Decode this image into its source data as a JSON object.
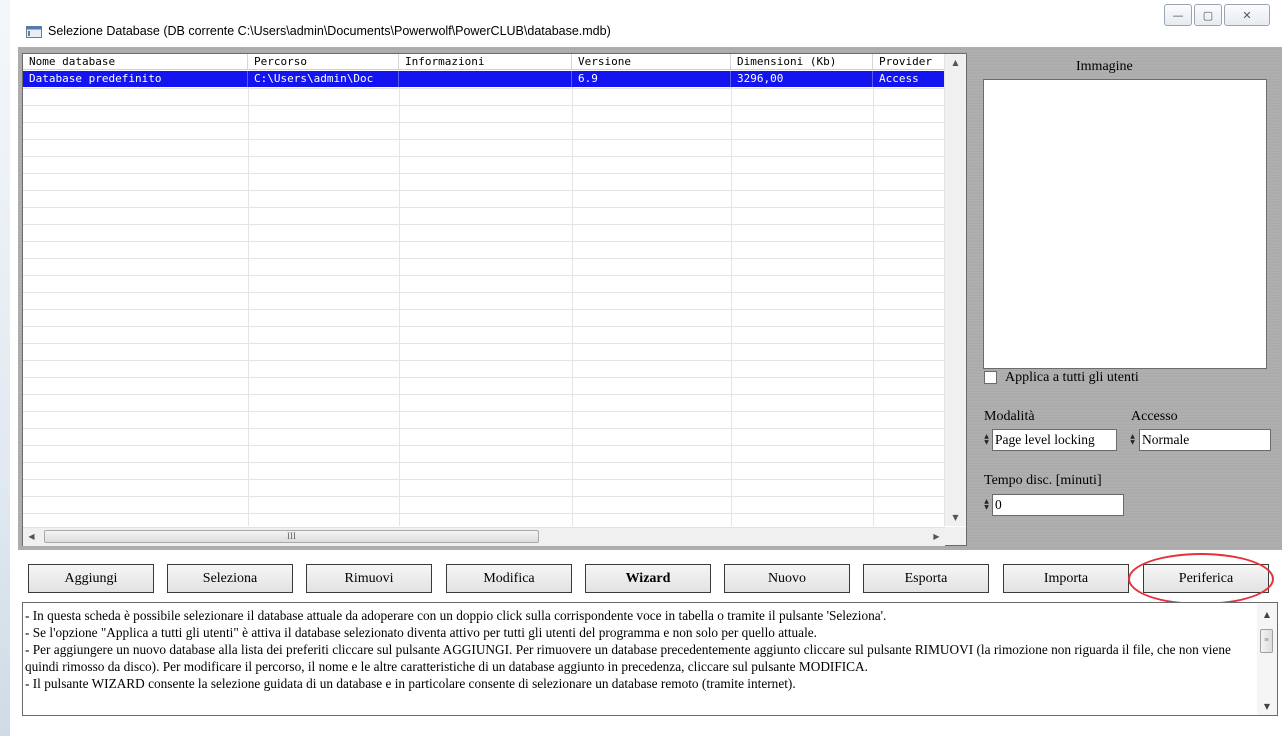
{
  "window": {
    "title": "Selezione Database (DB corrente C:\\Users\\admin\\Documents\\Powerwolf\\PowerCLUB\\database.mdb)",
    "controls": {
      "minimize": "—",
      "maximize": "▢",
      "close": "✕"
    }
  },
  "table": {
    "columns": [
      "Nome database",
      "Percorso",
      "Informazioni",
      "Versione",
      "Dimensioni (Kb)",
      "Provider"
    ],
    "rows": [
      [
        "Database predefinito",
        "C:\\Users\\admin\\Doc",
        "",
        "6.9",
        "3296,00",
        "Access"
      ]
    ],
    "hscroll_grip": "III"
  },
  "right_panel": {
    "image_label": "Immagine",
    "apply_all_label": "Applica a tutti gli utenti",
    "apply_all_checked": false,
    "mode_label": "Modalità",
    "mode_value": "Page level locking",
    "access_label": "Accesso",
    "access_value": "Normale",
    "timeout_label": "Tempo disc. [minuti]",
    "timeout_value": "0"
  },
  "buttons": {
    "add": "Aggiungi",
    "select": "Seleziona",
    "remove": "Rimuovi",
    "edit": "Modifica",
    "wizard": "Wizard",
    "new": "Nuovo",
    "export": "Esporta",
    "import": "Importa",
    "device": "Periferica"
  },
  "highlight_color": "#e8303a",
  "selection_color": "#1414f0",
  "info": {
    "lines": [
      "- In questa scheda è possibile selezionare il database attuale da adoperare con  un doppio click sulla corrispondente voce in tabella o tramite il pulsante 'Seleziona'.",
      "- Se l'opzione \"Applica a tutti gli utenti\" è attiva il database selezionato diventa attivo per tutti gli utenti del programma e non solo per quello attuale.",
      "- Per aggiungere un nuovo database alla lista dei preferiti cliccare sul pulsante AGGIUNGI. Per rimuovere un database precedentemente aggiunto cliccare sul pulsante RIMUOVI (la rimozione non riguarda il file, che non viene quindi rimosso da disco). Per modificare il percorso, il nome e le altre caratteristiche di un database aggiunto in precedenza, cliccare sul pulsante MODIFICA.",
      "- Il pulsante WIZARD consente la selezione guidata di un database e in particolare consente di selezionare un database remoto (tramite internet)."
    ]
  }
}
